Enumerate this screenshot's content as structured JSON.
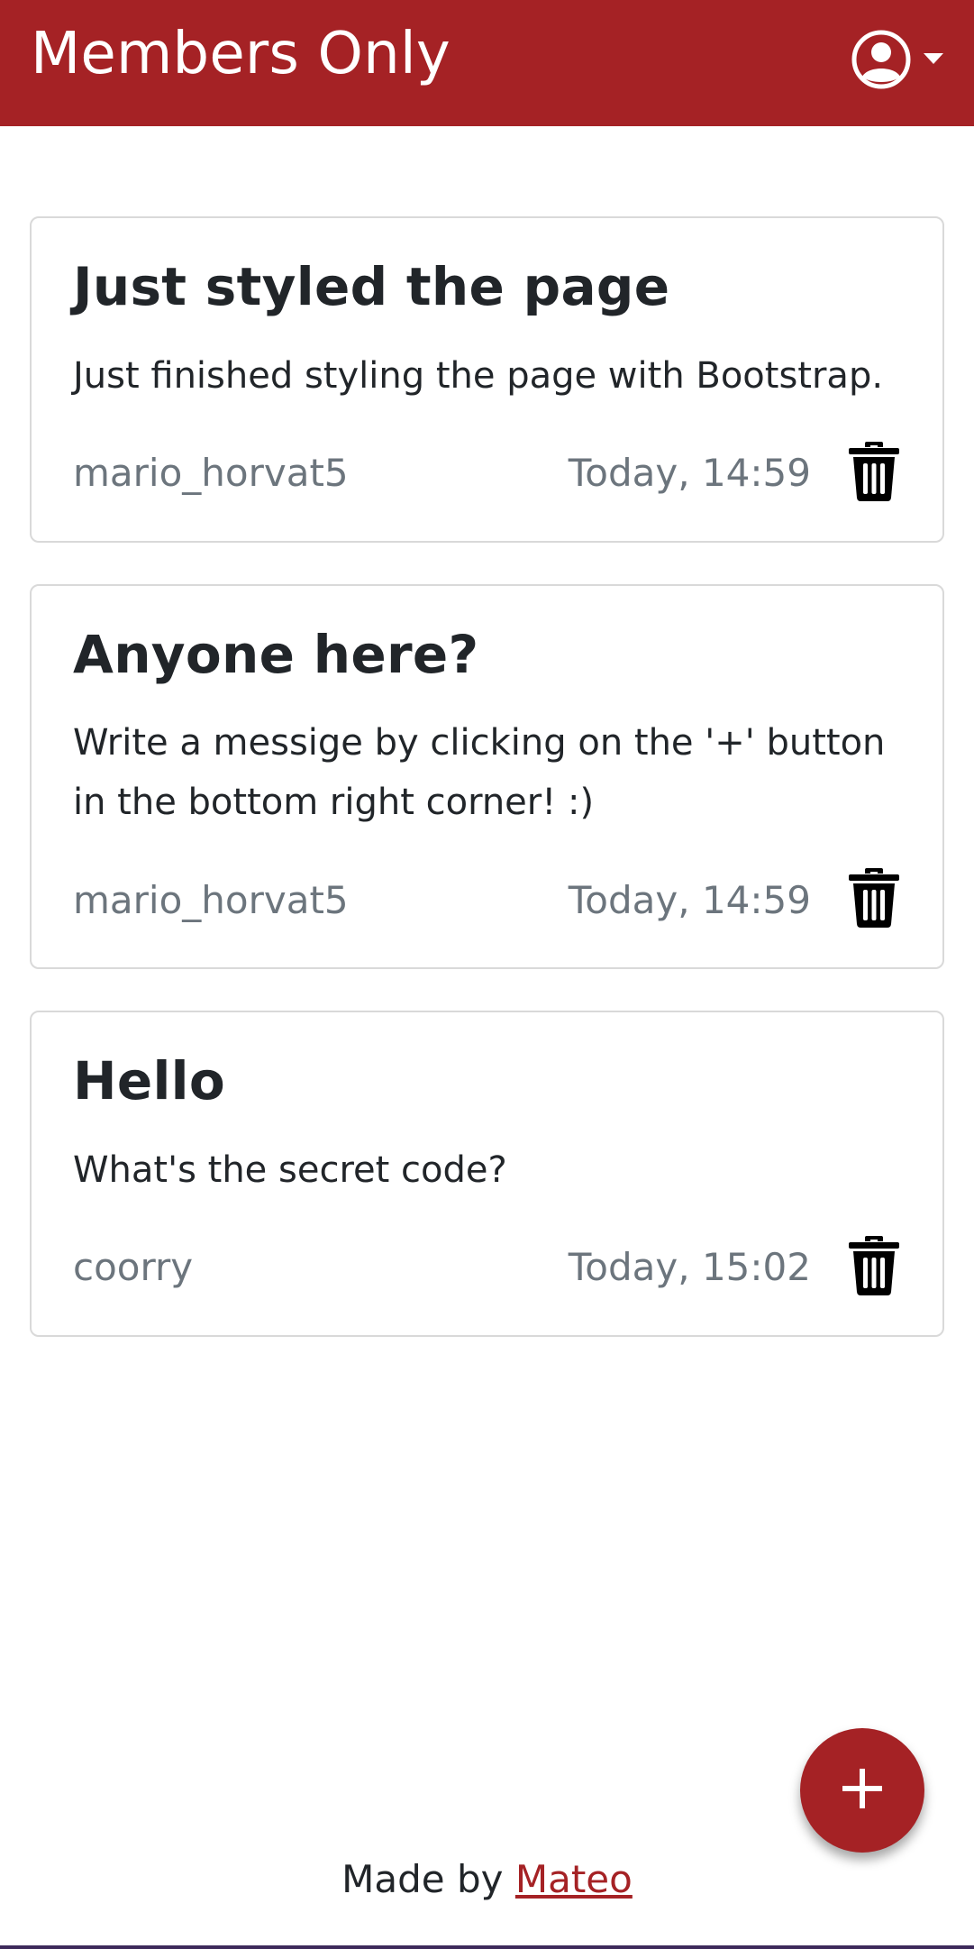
{
  "nav": {
    "brand": "Members Only",
    "icons": {
      "user": "user-circle-icon",
      "caret": "caret-down-icon"
    },
    "color": "#a52225"
  },
  "posts": [
    {
      "title": "Just styled the page",
      "body": "Just finished styling the page with Bootstrap.",
      "author": "mario_horvat5",
      "time": "Today, 14:59",
      "delete_icon": "trash-icon"
    },
    {
      "title": "Anyone here?",
      "body": "Write a messige by clicking on the '+' button in the bottom right corner! :)",
      "author": "mario_horvat5",
      "time": "Today, 14:59",
      "delete_icon": "trash-icon"
    },
    {
      "title": "Hello",
      "body": "What's the secret code?",
      "author": "coorry",
      "time": "Today, 15:02",
      "delete_icon": "trash-icon"
    }
  ],
  "fab": {
    "icon": "plus-icon",
    "label": "+"
  },
  "footer": {
    "prefix": "Made by ",
    "link_text": "Mateo"
  }
}
